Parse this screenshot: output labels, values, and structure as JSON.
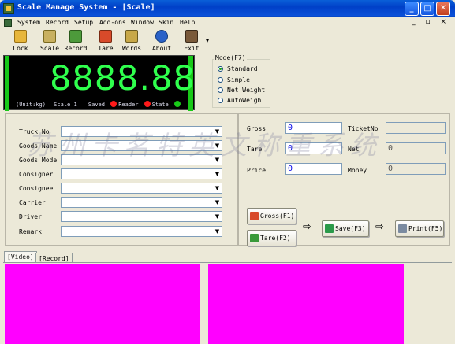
{
  "window": {
    "title": "Scale Manage System - [Scale]",
    "buttons": {
      "minimize": "_",
      "maximize": "□",
      "close": "✕"
    }
  },
  "menu": {
    "items": [
      "System",
      "Record",
      "Setup",
      "Add-ons",
      "Window",
      "Skin",
      "Help"
    ],
    "mdi_controls": "_ ▫ ×"
  },
  "toolbar": {
    "items": [
      {
        "label": "Lock",
        "icon": "lock-icon"
      },
      {
        "label": "Scale",
        "icon": "scale-icon"
      },
      {
        "label": "Record",
        "icon": "record-icon"
      },
      {
        "label": "Tare",
        "icon": "truck-icon"
      },
      {
        "label": "Words",
        "icon": "words-icon"
      },
      {
        "label": "About",
        "icon": "about-icon"
      },
      {
        "label": "Exit",
        "icon": "exit-icon"
      }
    ],
    "overflow": "▾"
  },
  "display": {
    "reading": "8888.88",
    "unit": "(Unit:kg)",
    "scale": "Scale 1",
    "saved": "Saved",
    "reader": "Reader",
    "state": "State",
    "colors": {
      "digits": "#2fff4d",
      "saved_led": "#ff1a1a",
      "reader_led": "#ff1a1a",
      "state_led": "#18c818"
    }
  },
  "mode": {
    "title": "Mode(F7)",
    "options": [
      "Standard",
      "Simple",
      "Net Weight",
      "AutoWeigh"
    ],
    "selected": "Standard"
  },
  "form": {
    "fields": [
      {
        "label": "Truck No",
        "value": ""
      },
      {
        "label": "Goods Name",
        "value": ""
      },
      {
        "label": "Goods Mode",
        "value": ""
      },
      {
        "label": "Consigner",
        "value": ""
      },
      {
        "label": "Consignee",
        "value": ""
      },
      {
        "label": "Carrier",
        "value": ""
      },
      {
        "label": "Driver",
        "value": ""
      },
      {
        "label": "Remark",
        "value": ""
      }
    ]
  },
  "weigh": {
    "gross_label": "Gross",
    "gross_value": "0",
    "tare_label": "Tare",
    "tare_value": "0",
    "price_label": "Price",
    "price_value": "0",
    "ticket_label": "TicketNo",
    "ticket_value": "",
    "net_label": "Net",
    "net_value": "0",
    "money_label": "Money",
    "money_value": "0"
  },
  "actions": {
    "gross": "Gross(F1)",
    "tare": "Tare(F2)",
    "save": "Save(F3)",
    "print": "Print(F5)"
  },
  "watermark": "苏州卡茗特英文称重系统",
  "tabs": [
    "[Video]",
    "[Record]"
  ]
}
